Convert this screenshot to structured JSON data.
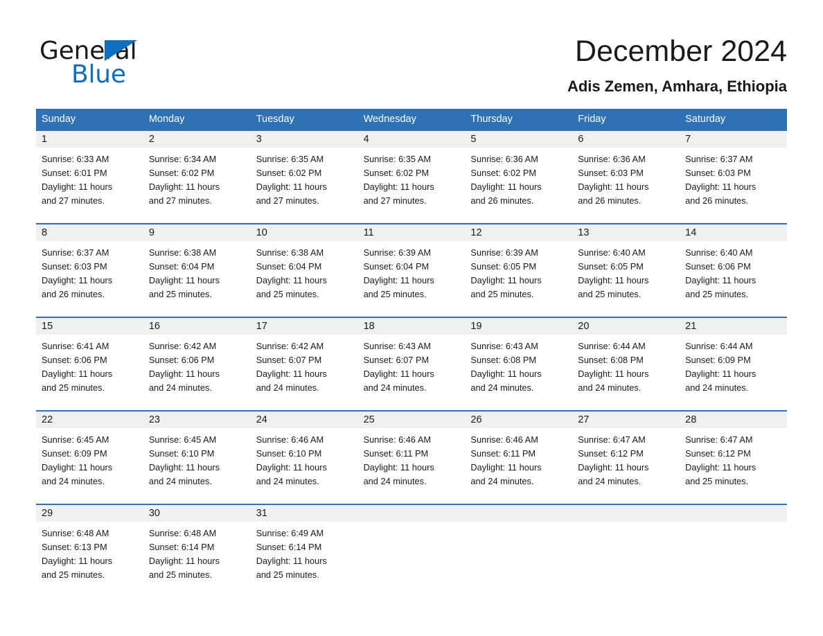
{
  "brand": {
    "name_part1": "General",
    "name_part2": "Blue",
    "accent_color": "#106EBE"
  },
  "header": {
    "title": "December 2024",
    "subtitle": "Adis Zemen, Amhara, Ethiopia"
  },
  "theme": {
    "header_blue": "#3071B4",
    "day_band_gray": "#F0F0F0",
    "text_color": "#1a1a1a"
  },
  "weekdays": [
    "Sunday",
    "Monday",
    "Tuesday",
    "Wednesday",
    "Thursday",
    "Friday",
    "Saturday"
  ],
  "weeks": [
    [
      {
        "day": "1",
        "sunrise": "Sunrise: 6:33 AM",
        "sunset": "Sunset: 6:01 PM",
        "daylight_line1": "Daylight: 11 hours",
        "daylight_line2": "and 27 minutes."
      },
      {
        "day": "2",
        "sunrise": "Sunrise: 6:34 AM",
        "sunset": "Sunset: 6:02 PM",
        "daylight_line1": "Daylight: 11 hours",
        "daylight_line2": "and 27 minutes."
      },
      {
        "day": "3",
        "sunrise": "Sunrise: 6:35 AM",
        "sunset": "Sunset: 6:02 PM",
        "daylight_line1": "Daylight: 11 hours",
        "daylight_line2": "and 27 minutes."
      },
      {
        "day": "4",
        "sunrise": "Sunrise: 6:35 AM",
        "sunset": "Sunset: 6:02 PM",
        "daylight_line1": "Daylight: 11 hours",
        "daylight_line2": "and 27 minutes."
      },
      {
        "day": "5",
        "sunrise": "Sunrise: 6:36 AM",
        "sunset": "Sunset: 6:02 PM",
        "daylight_line1": "Daylight: 11 hours",
        "daylight_line2": "and 26 minutes."
      },
      {
        "day": "6",
        "sunrise": "Sunrise: 6:36 AM",
        "sunset": "Sunset: 6:03 PM",
        "daylight_line1": "Daylight: 11 hours",
        "daylight_line2": "and 26 minutes."
      },
      {
        "day": "7",
        "sunrise": "Sunrise: 6:37 AM",
        "sunset": "Sunset: 6:03 PM",
        "daylight_line1": "Daylight: 11 hours",
        "daylight_line2": "and 26 minutes."
      }
    ],
    [
      {
        "day": "8",
        "sunrise": "Sunrise: 6:37 AM",
        "sunset": "Sunset: 6:03 PM",
        "daylight_line1": "Daylight: 11 hours",
        "daylight_line2": "and 26 minutes."
      },
      {
        "day": "9",
        "sunrise": "Sunrise: 6:38 AM",
        "sunset": "Sunset: 6:04 PM",
        "daylight_line1": "Daylight: 11 hours",
        "daylight_line2": "and 25 minutes."
      },
      {
        "day": "10",
        "sunrise": "Sunrise: 6:38 AM",
        "sunset": "Sunset: 6:04 PM",
        "daylight_line1": "Daylight: 11 hours",
        "daylight_line2": "and 25 minutes."
      },
      {
        "day": "11",
        "sunrise": "Sunrise: 6:39 AM",
        "sunset": "Sunset: 6:04 PM",
        "daylight_line1": "Daylight: 11 hours",
        "daylight_line2": "and 25 minutes."
      },
      {
        "day": "12",
        "sunrise": "Sunrise: 6:39 AM",
        "sunset": "Sunset: 6:05 PM",
        "daylight_line1": "Daylight: 11 hours",
        "daylight_line2": "and 25 minutes."
      },
      {
        "day": "13",
        "sunrise": "Sunrise: 6:40 AM",
        "sunset": "Sunset: 6:05 PM",
        "daylight_line1": "Daylight: 11 hours",
        "daylight_line2": "and 25 minutes."
      },
      {
        "day": "14",
        "sunrise": "Sunrise: 6:40 AM",
        "sunset": "Sunset: 6:06 PM",
        "daylight_line1": "Daylight: 11 hours",
        "daylight_line2": "and 25 minutes."
      }
    ],
    [
      {
        "day": "15",
        "sunrise": "Sunrise: 6:41 AM",
        "sunset": "Sunset: 6:06 PM",
        "daylight_line1": "Daylight: 11 hours",
        "daylight_line2": "and 25 minutes."
      },
      {
        "day": "16",
        "sunrise": "Sunrise: 6:42 AM",
        "sunset": "Sunset: 6:06 PM",
        "daylight_line1": "Daylight: 11 hours",
        "daylight_line2": "and 24 minutes."
      },
      {
        "day": "17",
        "sunrise": "Sunrise: 6:42 AM",
        "sunset": "Sunset: 6:07 PM",
        "daylight_line1": "Daylight: 11 hours",
        "daylight_line2": "and 24 minutes."
      },
      {
        "day": "18",
        "sunrise": "Sunrise: 6:43 AM",
        "sunset": "Sunset: 6:07 PM",
        "daylight_line1": "Daylight: 11 hours",
        "daylight_line2": "and 24 minutes."
      },
      {
        "day": "19",
        "sunrise": "Sunrise: 6:43 AM",
        "sunset": "Sunset: 6:08 PM",
        "daylight_line1": "Daylight: 11 hours",
        "daylight_line2": "and 24 minutes."
      },
      {
        "day": "20",
        "sunrise": "Sunrise: 6:44 AM",
        "sunset": "Sunset: 6:08 PM",
        "daylight_line1": "Daylight: 11 hours",
        "daylight_line2": "and 24 minutes."
      },
      {
        "day": "21",
        "sunrise": "Sunrise: 6:44 AM",
        "sunset": "Sunset: 6:09 PM",
        "daylight_line1": "Daylight: 11 hours",
        "daylight_line2": "and 24 minutes."
      }
    ],
    [
      {
        "day": "22",
        "sunrise": "Sunrise: 6:45 AM",
        "sunset": "Sunset: 6:09 PM",
        "daylight_line1": "Daylight: 11 hours",
        "daylight_line2": "and 24 minutes."
      },
      {
        "day": "23",
        "sunrise": "Sunrise: 6:45 AM",
        "sunset": "Sunset: 6:10 PM",
        "daylight_line1": "Daylight: 11 hours",
        "daylight_line2": "and 24 minutes."
      },
      {
        "day": "24",
        "sunrise": "Sunrise: 6:46 AM",
        "sunset": "Sunset: 6:10 PM",
        "daylight_line1": "Daylight: 11 hours",
        "daylight_line2": "and 24 minutes."
      },
      {
        "day": "25",
        "sunrise": "Sunrise: 6:46 AM",
        "sunset": "Sunset: 6:11 PM",
        "daylight_line1": "Daylight: 11 hours",
        "daylight_line2": "and 24 minutes."
      },
      {
        "day": "26",
        "sunrise": "Sunrise: 6:46 AM",
        "sunset": "Sunset: 6:11 PM",
        "daylight_line1": "Daylight: 11 hours",
        "daylight_line2": "and 24 minutes."
      },
      {
        "day": "27",
        "sunrise": "Sunrise: 6:47 AM",
        "sunset": "Sunset: 6:12 PM",
        "daylight_line1": "Daylight: 11 hours",
        "daylight_line2": "and 24 minutes."
      },
      {
        "day": "28",
        "sunrise": "Sunrise: 6:47 AM",
        "sunset": "Sunset: 6:12 PM",
        "daylight_line1": "Daylight: 11 hours",
        "daylight_line2": "and 25 minutes."
      }
    ],
    [
      {
        "day": "29",
        "sunrise": "Sunrise: 6:48 AM",
        "sunset": "Sunset: 6:13 PM",
        "daylight_line1": "Daylight: 11 hours",
        "daylight_line2": "and 25 minutes."
      },
      {
        "day": "30",
        "sunrise": "Sunrise: 6:48 AM",
        "sunset": "Sunset: 6:14 PM",
        "daylight_line1": "Daylight: 11 hours",
        "daylight_line2": "and 25 minutes."
      },
      {
        "day": "31",
        "sunrise": "Sunrise: 6:49 AM",
        "sunset": "Sunset: 6:14 PM",
        "daylight_line1": "Daylight: 11 hours",
        "daylight_line2": "and 25 minutes."
      },
      {
        "day": "",
        "sunrise": "",
        "sunset": "",
        "daylight_line1": "",
        "daylight_line2": ""
      },
      {
        "day": "",
        "sunrise": "",
        "sunset": "",
        "daylight_line1": "",
        "daylight_line2": ""
      },
      {
        "day": "",
        "sunrise": "",
        "sunset": "",
        "daylight_line1": "",
        "daylight_line2": ""
      },
      {
        "day": "",
        "sunrise": "",
        "sunset": "",
        "daylight_line1": "",
        "daylight_line2": ""
      }
    ]
  ]
}
